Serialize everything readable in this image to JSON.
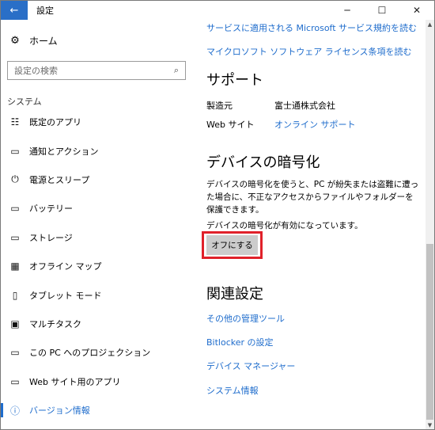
{
  "titlebar": {
    "back_icon": "←",
    "title": "設定",
    "minimize": "─",
    "maximize": "☐",
    "close": "✕"
  },
  "sidebar": {
    "home": {
      "icon": "⚙",
      "label": "ホーム"
    },
    "search": {
      "placeholder": "設定の検索",
      "icon": "⌕"
    },
    "section_label": "システム",
    "items": [
      {
        "label": "既定のアプリ",
        "icon": "☷",
        "active": false
      },
      {
        "label": "通知とアクション",
        "icon": "▭",
        "active": false
      },
      {
        "label": "電源とスリープ",
        "icon": "⏻",
        "active": false
      },
      {
        "label": "バッテリー",
        "icon": "▭",
        "active": false
      },
      {
        "label": "ストレージ",
        "icon": "▭",
        "active": false
      },
      {
        "label": "オフライン マップ",
        "icon": "▦",
        "active": false
      },
      {
        "label": "タブレット モード",
        "icon": "▯",
        "active": false
      },
      {
        "label": "マルチタスク",
        "icon": "▣",
        "active": false
      },
      {
        "label": "この PC へのプロジェクション",
        "icon": "▭",
        "active": false
      },
      {
        "label": "Web サイト用のアプリ",
        "icon": "▭",
        "active": false
      },
      {
        "label": "バージョン情報",
        "icon": "ⓘ",
        "active": true
      }
    ]
  },
  "content": {
    "links_top": [
      "サービスに適用される Microsoft サービス規約を読む",
      "マイクロソフト ソフトウェア ライセンス条項を読む"
    ],
    "support": {
      "heading": "サポート",
      "manufacturer_label": "製造元",
      "manufacturer_value": "富士通株式会社",
      "website_label": "Web サイト",
      "website_value": "オンライン サポート"
    },
    "encryption": {
      "heading": "デバイスの暗号化",
      "description": "デバイスの暗号化を使うと、PC が紛失または盗難に遭った場合に、不正なアクセスからファイルやフォルダーを保護できます。",
      "status": "デバイスの暗号化が有効になっています。",
      "button_label": "オフにする"
    },
    "related": {
      "heading": "関連設定",
      "links": [
        "その他の管理ツール",
        "Bitlocker の設定",
        "デバイス マネージャー",
        "システム情報"
      ]
    }
  },
  "scrollbar": {
    "up_icon": "▲",
    "down_icon": "▼"
  },
  "colors": {
    "accent": "#1e6ccc",
    "titlebar_back": "#2a6fc7",
    "highlight": "#e0212a"
  }
}
